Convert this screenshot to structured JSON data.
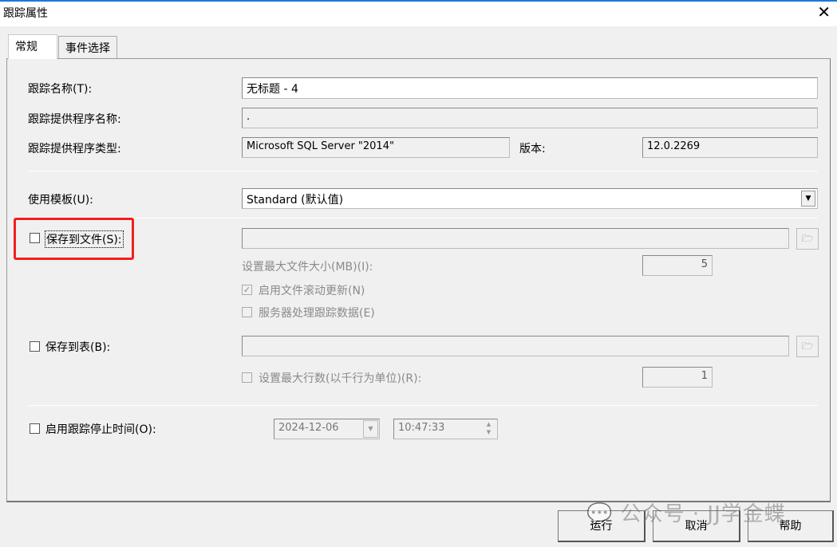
{
  "window": {
    "title": "跟踪属性",
    "close": "✕"
  },
  "tabs": [
    {
      "label": "常规"
    },
    {
      "label": "事件选择"
    }
  ],
  "general": {
    "trace_name_label": "跟踪名称(T):",
    "trace_name_value": "无标题 - 4",
    "provider_name_label": "跟踪提供程序名称:",
    "provider_name_value": ".",
    "provider_type_label": "跟踪提供程序类型:",
    "provider_type_value": "Microsoft SQL Server \"2014\"",
    "version_label": "版本:",
    "version_value": "12.0.2269",
    "template_label": "使用模板(U):",
    "template_value": "Standard (默认值)",
    "save_to_file_label": "保存到文件(S):",
    "max_file_size_label": "设置最大文件大小(MB)(I):",
    "max_file_size_value": "5",
    "rollover_label": "启用文件滚动更新(N)",
    "server_process_label": "服务器处理跟踪数据(E)",
    "save_to_table_label": "保存到表(B):",
    "max_rows_label": "设置最大行数(以千行为单位)(R):",
    "max_rows_value": "1",
    "stop_time_label": "启用跟踪停止时间(O):",
    "stop_date": "2024-12-06",
    "stop_time": "10:47:33"
  },
  "buttons": {
    "run": "运行",
    "cancel": "取消",
    "help": "帮助"
  },
  "watermark": "公众号 · JJ学金蝶"
}
